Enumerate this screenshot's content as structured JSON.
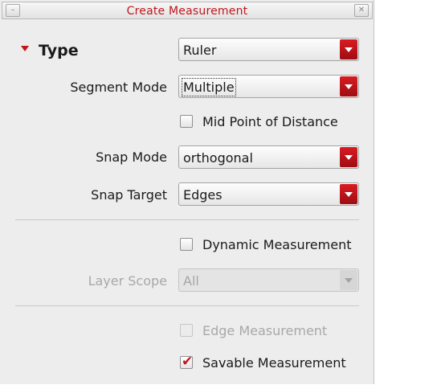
{
  "window": {
    "title": "Create Measurement",
    "min_icon": "minimize-icon",
    "close_icon": "close-icon"
  },
  "type_section": {
    "label": "Type"
  },
  "type_combo": {
    "value": "Ruler"
  },
  "segment_mode": {
    "label": "Segment Mode",
    "value": "Multiple"
  },
  "mid_point": {
    "label": "Mid Point of Distance",
    "checked": false
  },
  "snap_mode": {
    "label": "Snap Mode",
    "value": "orthogonal"
  },
  "snap_target": {
    "label": "Snap Target",
    "value": "Edges"
  },
  "dynamic_measurement": {
    "label": "Dynamic Measurement",
    "checked": false
  },
  "layer_scope": {
    "label": "Layer Scope",
    "value": "All",
    "enabled": false
  },
  "edge_measurement": {
    "label": "Edge Measurement",
    "checked": false,
    "enabled": false
  },
  "savable_measurement": {
    "label": "Savable Measurement",
    "checked": true,
    "check_glyph": "✔"
  },
  "colors": {
    "accent": "#c0161c",
    "panel_bg": "#ededed",
    "disabled_text": "#a8a8a8"
  }
}
